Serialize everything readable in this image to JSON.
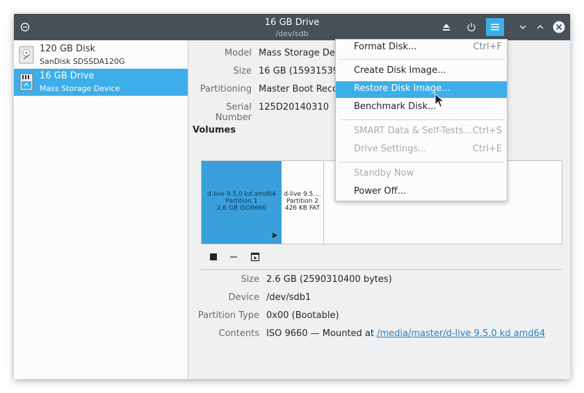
{
  "window": {
    "title": "16 GB Drive",
    "subtitle": "/dev/sdb"
  },
  "titlebar_icons": {
    "left": "app-menu-icon",
    "eject": "eject-icon",
    "power": "power-icon",
    "menu": "hamburger-menu-icon",
    "minimize": "minimize-icon",
    "maximize": "maximize-icon",
    "close": "close-icon"
  },
  "sidebar": {
    "items": [
      {
        "name": "120 GB Disk",
        "desc": "SanDisk SDSSDA120G",
        "icon": "hard-disk-icon",
        "selected": false
      },
      {
        "name": "16 GB Drive",
        "desc": "Mass Storage Device",
        "icon": "sd-card-icon",
        "selected": true
      }
    ]
  },
  "drive_props": [
    {
      "label": "Model",
      "value": "Mass Storage Device"
    },
    {
      "label": "Size",
      "value": "16 GB (15931539456 bytes)"
    },
    {
      "label": "Partitioning",
      "value": "Master Boot Record"
    },
    {
      "label": "Serial Number",
      "value": "125D20140310"
    }
  ],
  "volumes": {
    "title": "Volumes",
    "partitions": [
      {
        "lines": [
          "d-live 9.5.0 kd amd64",
          "Partition 1",
          "2.6 GB ISO9660"
        ],
        "selected": true
      },
      {
        "lines": [
          "d-live 9.5....",
          "Partition 2",
          "426 KB FAT"
        ],
        "selected": false
      }
    ],
    "tools": [
      "stop-icon",
      "minus-icon",
      "partition-options-icon"
    ]
  },
  "partition_props": [
    {
      "label": "Size",
      "value": "2.6 GB (2590310400 bytes)"
    },
    {
      "label": "Device",
      "value": "/dev/sdb1"
    },
    {
      "label": "Partition Type",
      "value": "0x00 (Bootable)"
    },
    {
      "label": "Contents",
      "value": "ISO 9660 — Mounted at ",
      "link": "/media/master/d-live 9.5.0 kd amd64"
    }
  ],
  "menu": {
    "items": [
      {
        "label": "Format Disk...",
        "shortcut": "Ctrl+F",
        "disabled": false
      },
      {
        "label": "Create Disk Image...",
        "shortcut": "",
        "disabled": false
      },
      {
        "label": "Restore Disk Image...",
        "shortcut": "",
        "disabled": false,
        "highlighted": true
      },
      {
        "label": "Benchmark Disk...",
        "shortcut": "",
        "disabled": false
      },
      {
        "label": "SMART Data & Self-Tests...",
        "shortcut": "Ctrl+S",
        "disabled": true
      },
      {
        "label": "Drive Settings...",
        "shortcut": "Ctrl+E",
        "disabled": true
      },
      {
        "label": "Standby Now",
        "shortcut": "",
        "disabled": true
      },
      {
        "label": "Power Off...",
        "shortcut": "",
        "disabled": false
      }
    ]
  },
  "colors": {
    "titlebar": "#475057",
    "accent": "#3daee9",
    "partition_selected": "#3a9fdb"
  }
}
